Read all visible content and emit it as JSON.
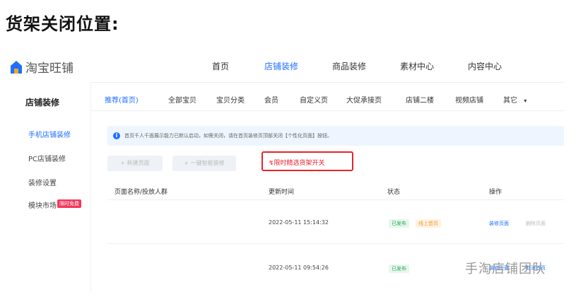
{
  "heading": "货架关闭位置:",
  "brand": {
    "name": "淘宝旺铺"
  },
  "top_nav": [
    "首页",
    "店铺装修",
    "商品装修",
    "素材中心",
    "内容中心"
  ],
  "left_nav": {
    "title": "店铺装修",
    "items": [
      {
        "label": "手机店铺装修"
      },
      {
        "label": "PC店铺装修"
      },
      {
        "label": "装修设置"
      },
      {
        "label": "模块市场",
        "badge": "限时免费"
      }
    ]
  },
  "tabs": [
    "推荐(首页)",
    "全部宝贝",
    "宝贝分类",
    "会员",
    "自定义页",
    "大促承接页",
    "店铺二楼",
    "视频店铺",
    "其它"
  ],
  "notice": "首页千人千面展示能力已默认启动，如需关闭，请在首页装修页顶部关闭【个性化页面】按钮。",
  "buttons": {
    "new_page": "+ 新建页面",
    "one_click": "+ 一键智能装修"
  },
  "highlight": "限时精选货架开关",
  "table": {
    "headers": [
      "页面名称/投放人群",
      "更新时间",
      "状态",
      "操作"
    ],
    "rows": [
      {
        "time": "2022-05-11 15:14:32",
        "status": [
          "已发布",
          "线上首页"
        ],
        "actions": [
          "装修页面",
          "删除页面"
        ]
      },
      {
        "time": "2022-05-11 09:54:26",
        "status": [
          "已发布"
        ],
        "actions": [
          "装修页面",
          "取消首页"
        ]
      }
    ]
  },
  "watermark": "手淘店铺团队",
  "colors": {
    "accent": "#1e6fff",
    "highlight_border": "#e8232c"
  }
}
